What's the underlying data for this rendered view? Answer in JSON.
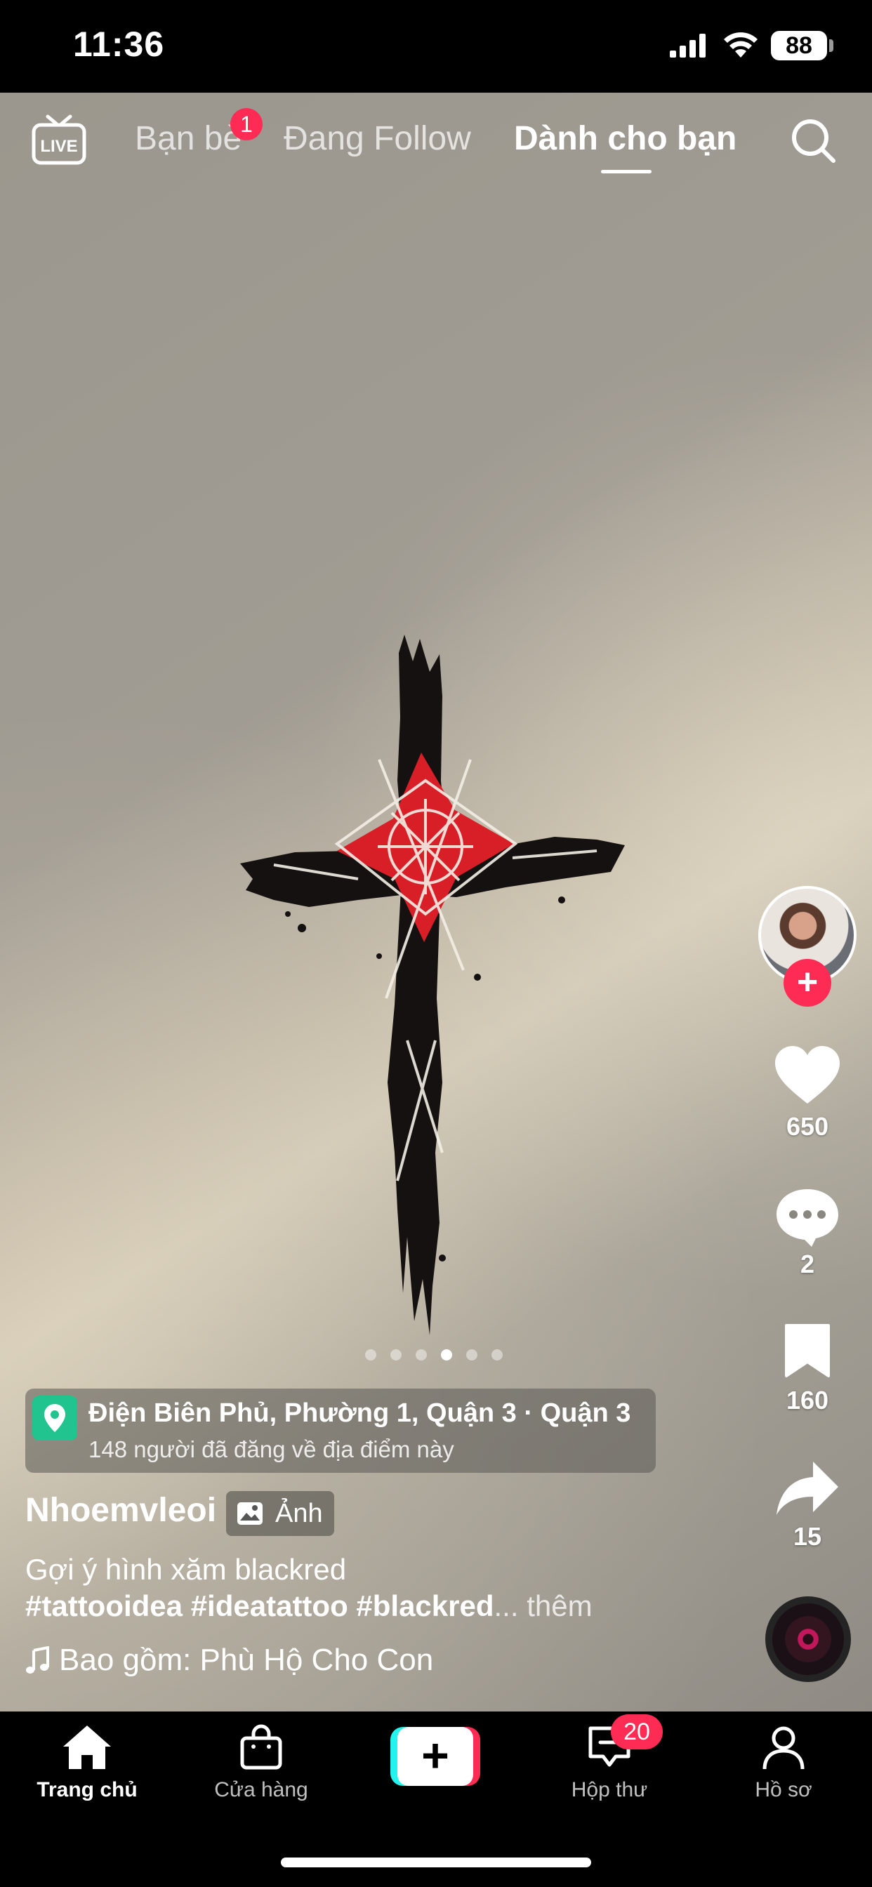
{
  "status_bar": {
    "time": "11:36",
    "battery": "88"
  },
  "top_nav": {
    "live_label": "LIVE",
    "tabs": [
      {
        "label": "Bạn bè",
        "badge": "1",
        "active": false
      },
      {
        "label": "Đang Follow",
        "active": false
      },
      {
        "label": "Dành cho bạn",
        "active": true
      }
    ],
    "search_icon": "search-icon"
  },
  "post": {
    "image_pages": 6,
    "current_page": 4,
    "location": {
      "title": "Điện Biên Phủ, Phường 1, Quận 3 · Quận 3",
      "subtitle": "148 người đã đăng về địa điểm này"
    },
    "username": "Nhoemvleoi",
    "type_badge": "Ảnh",
    "caption": "Gợi ý hình xăm blackred",
    "hashtags": "#tattooidea #ideatattoo #blackred",
    "ellipsis": "...",
    "more_label": " thêm",
    "music": "Bao gồm: Phù Hộ Cho Con"
  },
  "actions": {
    "likes": "650",
    "comments": "2",
    "saves": "160",
    "shares": "15"
  },
  "bottom_nav": {
    "home": "Trang chủ",
    "shop": "Cửa hàng",
    "create": "+",
    "inbox": "Hộp thư",
    "inbox_badge": "20",
    "profile": "Hồ sơ"
  },
  "colors": {
    "accent": "#fe2c55",
    "create_cyan": "#25f4ee",
    "location_pin": "#21c48f",
    "tattoo_red": "#d81e26"
  }
}
